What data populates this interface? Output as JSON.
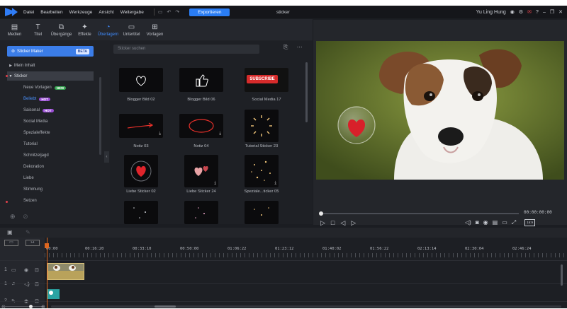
{
  "menu": [
    "Datei",
    "Bearbeiten",
    "Werkzeuge",
    "Ansicht",
    "Weitergabe"
  ],
  "toolbar": {
    "export_label": "Exportieren"
  },
  "document_title": "sticker",
  "user_name": "Yu Ling Hung",
  "tabs": [
    {
      "label": "Medien",
      "icon": "folder-icon"
    },
    {
      "label": "Titel",
      "icon": "title-icon"
    },
    {
      "label": "Übergänge",
      "icon": "transition-icon"
    },
    {
      "label": "Effekte",
      "icon": "effects-icon"
    },
    {
      "label": "Überlagern",
      "icon": "overlay-icon",
      "active": true
    },
    {
      "label": "Untertitel",
      "icon": "subtitle-icon"
    },
    {
      "label": "Vorlagen",
      "icon": "templates-icon"
    }
  ],
  "sidebar": {
    "sticker_maker": "Sticker Maker",
    "beta": "BETA",
    "my_content": "Mein Inhalt",
    "sticker": "Sticker",
    "items": [
      {
        "label": "Neue Vorlagen",
        "badge": "NEW",
        "badge_color": "#3aa755"
      },
      {
        "label": "Beliebt",
        "badge": "HOT",
        "badge_color": "#9b4fd6",
        "active": true
      },
      {
        "label": "Saisonal",
        "badge": "HOT",
        "badge_color": "#9b4fd6"
      },
      {
        "label": "Social Media"
      },
      {
        "label": "Spezialeffekte"
      },
      {
        "label": "Tutorial"
      },
      {
        "label": "Schnitzeljagd"
      },
      {
        "label": "Dekoration"
      },
      {
        "label": "Liebe"
      },
      {
        "label": "Stimmung"
      },
      {
        "label": "Setzen"
      }
    ]
  },
  "search": {
    "placeholder": "Sticker suchen"
  },
  "stickers": [
    {
      "label": "Blogger Bild 02"
    },
    {
      "label": "Blogger Bild 06"
    },
    {
      "label": "Social Media 17",
      "subscribe": "SUBSCRIBE"
    },
    {
      "label": "Notiz 03"
    },
    {
      "label": "Notiz 04"
    },
    {
      "label": "Tutorial Sticker 23"
    },
    {
      "label": "Liebe Sticker 02"
    },
    {
      "label": "Liebe Sticker 24"
    },
    {
      "label": "Speziale...ticker 05"
    }
  ],
  "preview": {
    "timecode": "00:00:00:00",
    "ratio": "16:9"
  },
  "timeline": {
    "ruler": [
      "00:00",
      "00:16:20",
      "00:33:10",
      "00:50:00",
      "01:06:22",
      "01:23:12",
      "01:40:02",
      "01:56:22",
      "02:13:14",
      "02:30:04",
      "02:46:24"
    ]
  },
  "colors": {
    "accent": "#2a7df4",
    "playhead": "#e0671f"
  }
}
